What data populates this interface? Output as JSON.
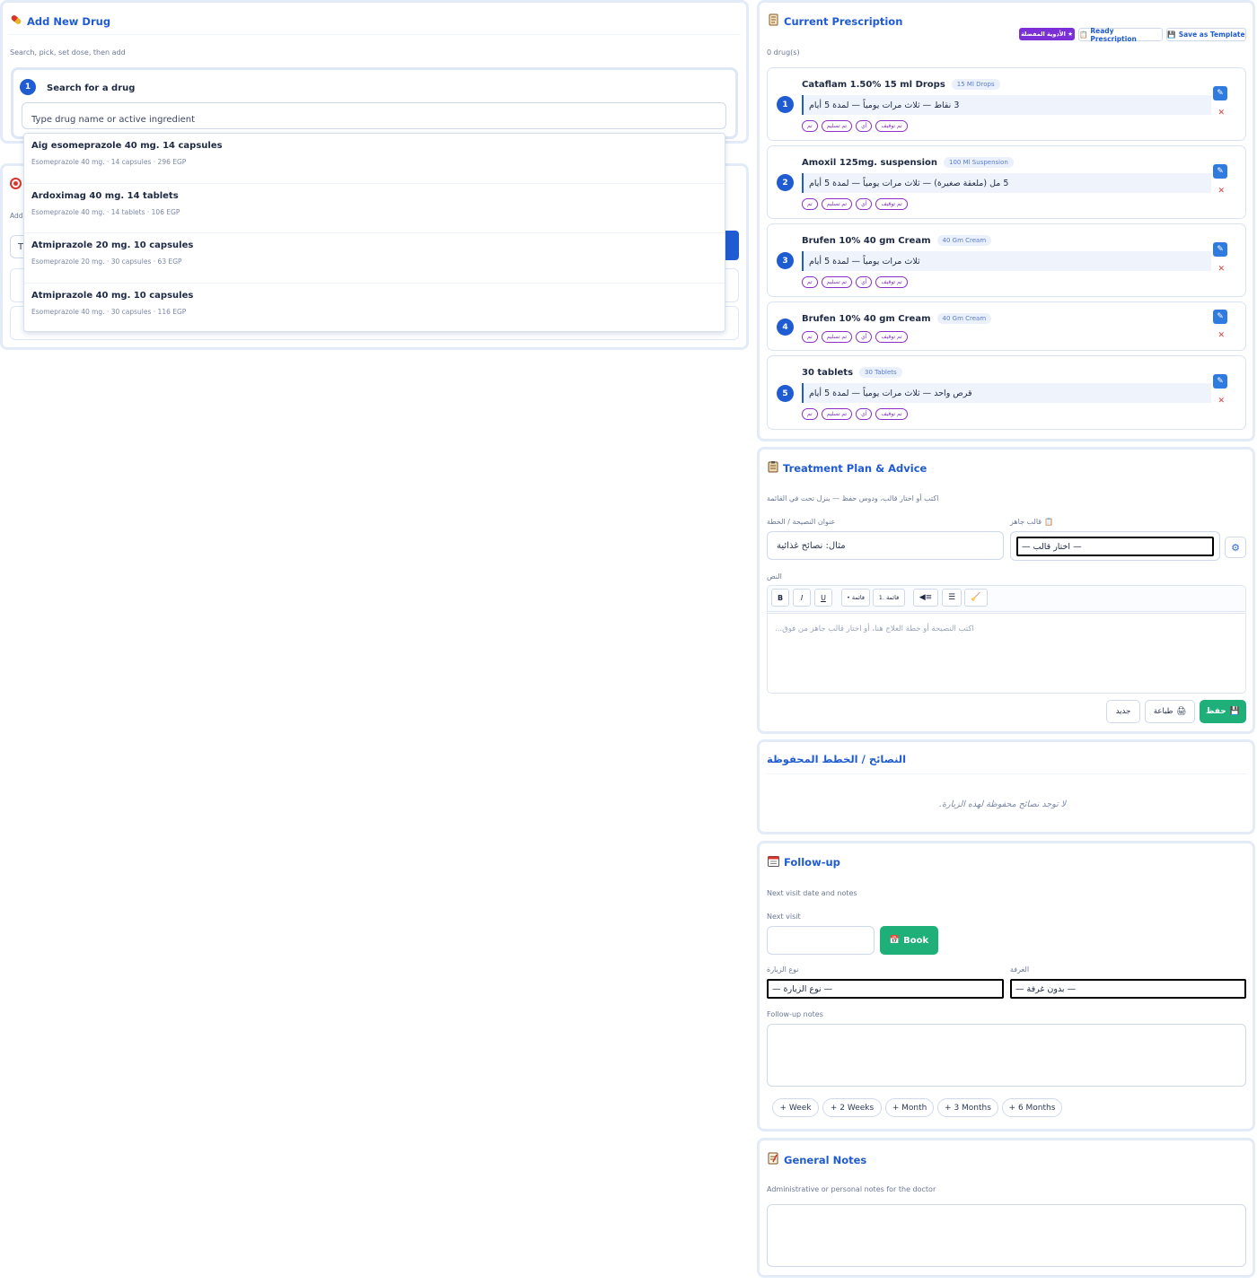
{
  "add_drug": {
    "title": "Add New Drug",
    "subtitle": "Search, pick, set dose, then add",
    "step_number": "1",
    "step_label": "Search for a drug",
    "search_placeholder": "Type drug name or active ingredient",
    "results": [
      {
        "name": "Aig esomeprazole 40 mg. 14 capsules",
        "meta": "Esomeprazole 40 mg. · 14 capsules · 296 EGP"
      },
      {
        "name": "Ardoximag 40 mg. 14 tablets",
        "meta": "Esomeprazole 40 mg. · 14 tablets · 106 EGP"
      },
      {
        "name": "Atmiprazole 20 mg. 10 capsules",
        "meta": "Esomeprazole 20 mg. · 30 capsules · 63 EGP"
      },
      {
        "name": "Atmiprazole 40 mg. 10 capsules",
        "meta": "Esomeprazole 40 mg. · 30 capsules · 116 EGP"
      }
    ],
    "behind_label": "Add",
    "behind_input": "T"
  },
  "prescription": {
    "title": "Current Prescription",
    "count": "0 drug(s)",
    "favorites_label": "★ الأدوية المفضلة",
    "ready_label": "Ready Prescription",
    "template_label": "Save as Template",
    "items": [
      {
        "num": "1",
        "name": "Cataflam 1.50% 15 ml Drops",
        "form": "15 Ml Drops",
        "dose": "3 نقاط — ثلاث مرات يومياً — لمدة 5 أيام"
      },
      {
        "num": "2",
        "name": "Amoxil 125mg. suspension",
        "form": "100 Ml Suspension",
        "dose": "5 مل (ملعقة صغيرة) — ثلاث مرات يومياً — لمدة 5 أيام"
      },
      {
        "num": "3",
        "name": "Brufen 10% 40 gm Cream",
        "form": "40 Gm Cream",
        "dose": "ثلاث مرات يومياً — لمدة 5 أيام"
      },
      {
        "num": "4",
        "name": "Brufen 10% 40 gm Cream",
        "form": "40 Gm Cream",
        "dose": ""
      },
      {
        "num": "5",
        "name": "30 tablets",
        "form": "30 Tablets",
        "dose": "قرص واحد — ثلاث مرات يومياً — لمدة 5 أيام"
      }
    ],
    "tags": [
      "تم",
      "تم تسليم",
      "أي",
      "تم توقيف"
    ]
  },
  "treatment": {
    "title": "Treatment Plan & Advice",
    "hint": "اكتب أو اختار قالب، ودوس حفظ — ينزل تحت في القائمة",
    "title_label": "عنوان النصيحة / الخطة",
    "title_placeholder": "مثال: نصائح غذائية",
    "template_label": "قالب جاهز",
    "template_value": "— اختار قالب —",
    "text_label": "النص",
    "toolbar": [
      "B",
      "I",
      "U",
      "• قائمة",
      "1. قائمة",
      "◀≡",
      "☰",
      "🧹"
    ],
    "text_placeholder": "اكتب النصيحة أو خطة العلاج هنا، أو اختار قالب جاهز من فوق...",
    "save_label": "حفظ",
    "print_label": "طباعة",
    "new_label": "جديد"
  },
  "saved": {
    "title": "النصائح / الخطط المحفوظة",
    "empty": "لا توجد نصائح محفوظة لهذه الزيارة."
  },
  "followup": {
    "title": "Follow-up",
    "subtitle": "Next visit date and notes",
    "next_visit_label": "Next visit",
    "book_label": "Book",
    "visit_type_label": "نوع الزيارة",
    "visit_type_value": "— نوع الزيارة —",
    "room_label": "الغرفة",
    "room_value": "— بدون غرفة —",
    "notes_label": "Follow-up notes",
    "quick": [
      "+ Week",
      "+ 2 Weeks",
      "+ Month",
      "+ 3 Months",
      "+ 6 Months"
    ]
  },
  "general_notes": {
    "title": "General Notes",
    "subtitle": "Administrative or personal notes for the doctor"
  },
  "colors": {
    "accent": "#1f5bd1",
    "green": "#1fb07a",
    "purple": "#8b2fc8",
    "delete": "#e03a3a"
  }
}
